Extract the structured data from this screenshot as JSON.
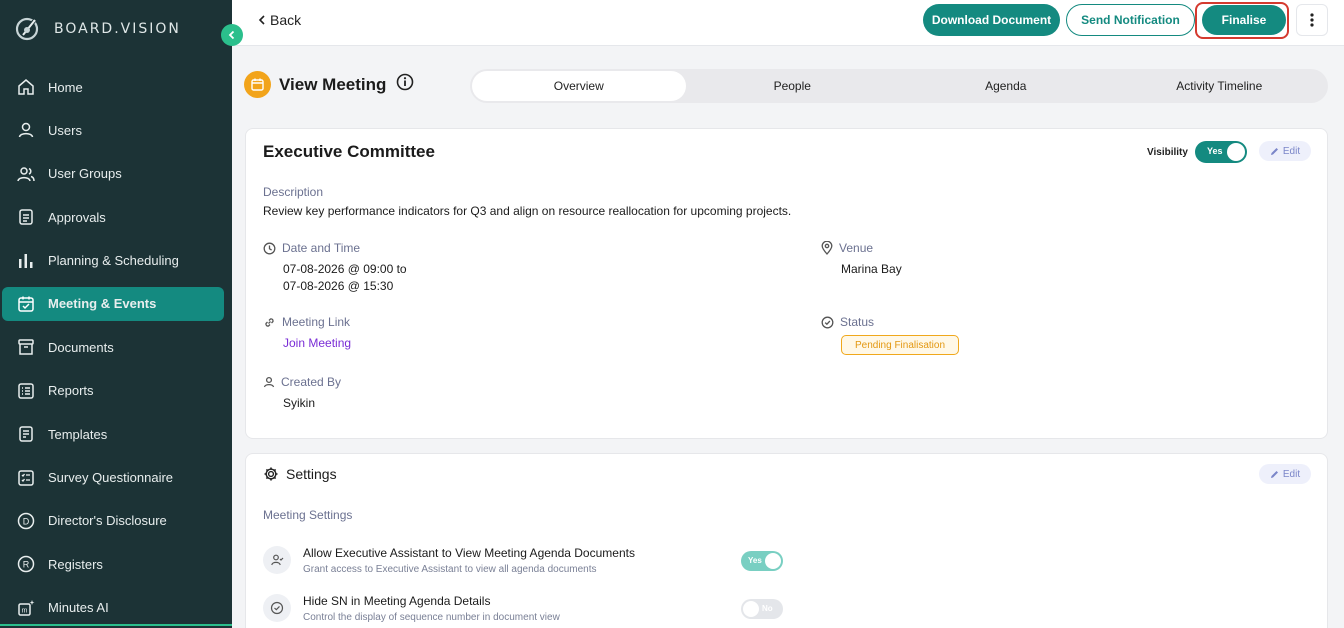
{
  "app": {
    "brand": "BOARD.VISION"
  },
  "sidebar": {
    "items": [
      {
        "label": "Home",
        "icon": "home-icon"
      },
      {
        "label": "Users",
        "icon": "user-icon"
      },
      {
        "label": "User Groups",
        "icon": "users-icon"
      },
      {
        "label": "Approvals",
        "icon": "approvals-icon"
      },
      {
        "label": "Planning & Scheduling",
        "icon": "bar-chart-icon"
      },
      {
        "label": "Meeting & Events",
        "icon": "calendar-check-icon",
        "active": true
      },
      {
        "label": "Documents",
        "icon": "archive-icon"
      },
      {
        "label": "Reports",
        "icon": "list-icon"
      },
      {
        "label": "Templates",
        "icon": "template-icon"
      },
      {
        "label": "Survey Questionnaire",
        "icon": "survey-icon"
      },
      {
        "label": "Director's Disclosure",
        "icon": "letter-d-icon"
      },
      {
        "label": "Registers",
        "icon": "letter-r-icon"
      },
      {
        "label": "Minutes AI",
        "icon": "minutes-ai-icon"
      }
    ]
  },
  "topbar": {
    "back_label": "Back",
    "download_label": "Download Document",
    "notify_label": "Send Notification",
    "finalise_label": "Finalise"
  },
  "page": {
    "title": "View Meeting",
    "tabs": [
      {
        "label": "Overview",
        "active": true
      },
      {
        "label": "People"
      },
      {
        "label": "Agenda"
      },
      {
        "label": "Activity Timeline"
      }
    ]
  },
  "meeting": {
    "name": "Executive Committee",
    "visibility_label": "Visibility",
    "visibility_value": "Yes",
    "edit_label": "Edit",
    "description_label": "Description",
    "description": "Review key performance indicators for Q3 and align on resource reallocation for upcoming projects.",
    "datetime_label": "Date and Time",
    "datetime_start": "07-08-2026 @ 09:00 to",
    "datetime_end": "07-08-2026 @ 15:30",
    "venue_label": "Venue",
    "venue": "Marina Bay",
    "link_label": "Meeting Link",
    "link_text": "Join Meeting",
    "status_label": "Status",
    "status": "Pending Finalisation",
    "created_label": "Created By",
    "created_by": "Syikin"
  },
  "settings": {
    "title": "Settings",
    "edit_label": "Edit",
    "section_label": "Meeting Settings",
    "items": [
      {
        "title": "Allow Executive Assistant to View Meeting Agenda Documents",
        "desc": "Grant access to Executive Assistant to view all agenda documents",
        "toggle": "Yes"
      },
      {
        "title": "Hide SN in Meeting Agenda Details",
        "desc": "Control the display of sequence number in document view",
        "toggle": "No"
      }
    ]
  },
  "colors": {
    "primary": "#148a80",
    "sidebar": "#1c3336",
    "accent_green": "#2bbf8c",
    "warning": "#f0a81c",
    "highlight_ring": "#d43a2f"
  }
}
